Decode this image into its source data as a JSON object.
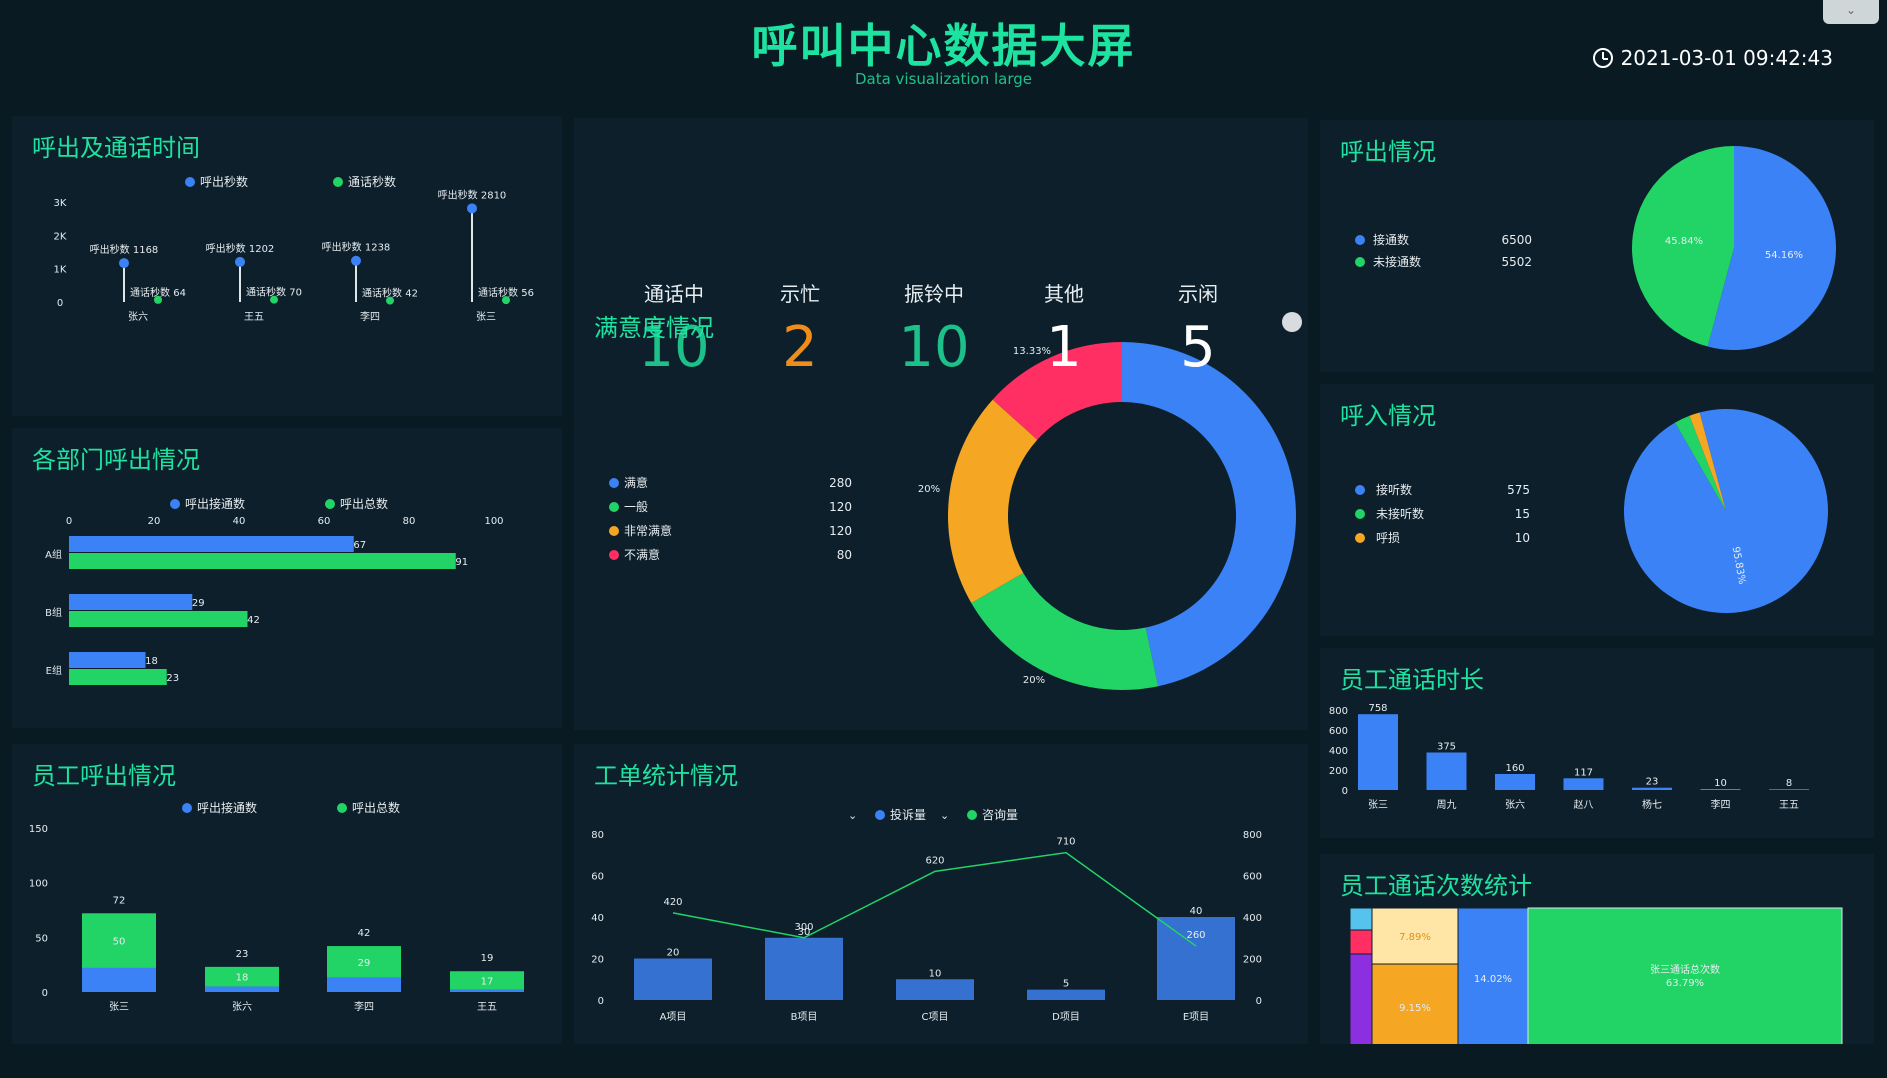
{
  "header": {
    "title": "呼叫中心数据大屏",
    "subtitle": "Data visualization large",
    "datetime": "2021-03-01 09:42:43"
  },
  "status": [
    {
      "label": "通话中",
      "value": "10",
      "color": "#1ec08a"
    },
    {
      "label": "示忙",
      "value": "2",
      "color": "#f08c1a"
    },
    {
      "label": "振铃中",
      "value": "10",
      "color": "#1ec08a"
    },
    {
      "label": "其他",
      "value": "1",
      "color": "#ffffff"
    },
    {
      "label": "示闲",
      "value": "5",
      "color": "#ffffff"
    }
  ],
  "panels": {
    "call_time": "呼出及通话时间",
    "dept": "各部门呼出情况",
    "staff_out": "员工呼出情况",
    "satisfaction": "满意度情况",
    "tickets": "工单统计情况",
    "outbound": "呼出情况",
    "inbound": "呼入情况",
    "duration": "员工通话时长",
    "count": "员工通话次数统计"
  },
  "colors": {
    "blue": "#3b82f6",
    "green": "#22d366",
    "orange": "#f5a623",
    "red": "#ff2e63"
  },
  "chart_data": [
    {
      "id": "call_time",
      "type": "scatter",
      "legend": [
        "呼出秒数",
        "通话秒数"
      ],
      "categories": [
        "张六",
        "王五",
        "李四",
        "张三"
      ],
      "series": [
        {
          "name": "呼出秒数",
          "values": [
            1168,
            1202,
            1238,
            2810
          ]
        },
        {
          "name": "通话秒数",
          "values": [
            64,
            70,
            42,
            56
          ]
        }
      ],
      "ylim": [
        0,
        3000
      ],
      "yticks": [
        "0",
        "1K",
        "2K",
        "3K"
      ]
    },
    {
      "id": "dept",
      "type": "bar",
      "orientation": "horizontal",
      "legend": [
        "呼出接通数",
        "呼出总数"
      ],
      "categories": [
        "A组",
        "B组",
        "E组"
      ],
      "series": [
        {
          "name": "呼出接通数",
          "values": [
            67,
            29,
            18
          ]
        },
        {
          "name": "呼出总数",
          "values": [
            91,
            42,
            23
          ]
        }
      ],
      "xlim": [
        0,
        100
      ],
      "xticks": [
        "0",
        "20",
        "40",
        "60",
        "80",
        "100"
      ]
    },
    {
      "id": "staff_out",
      "type": "bar",
      "stacked": true,
      "legend": [
        "呼出接通数",
        "呼出总数"
      ],
      "categories": [
        "张三",
        "张六",
        "李四",
        "王五"
      ],
      "series": [
        {
          "name": "呼出接通数",
          "values": [
            22,
            5,
            13,
            2
          ]
        },
        {
          "name": "呼出总数",
          "values": [
            50,
            18,
            29,
            17
          ]
        }
      ],
      "totals": [
        72,
        23,
        42,
        19
      ],
      "ylim": [
        0,
        150
      ],
      "yticks": [
        "0",
        "50",
        "100",
        "150"
      ]
    },
    {
      "id": "satisfaction",
      "type": "pie",
      "donut": true,
      "items": [
        {
          "name": "满意",
          "value": 280
        },
        {
          "name": "一般",
          "value": 120
        },
        {
          "name": "非常满意",
          "value": 120
        },
        {
          "name": "不满意",
          "value": 80
        }
      ],
      "labels": [
        "",
        "20%",
        "20%",
        "13.33%"
      ]
    },
    {
      "id": "tickets",
      "type": "bar",
      "legend": [
        "投诉量",
        "咨询量"
      ],
      "categories": [
        "A项目",
        "B项目",
        "C项目",
        "D项目",
        "E项目"
      ],
      "series": [
        {
          "name": "投诉量",
          "values": [
            20,
            30,
            10,
            5,
            40
          ]
        },
        {
          "name": "咨询量",
          "type": "line",
          "values": [
            420,
            300,
            620,
            710,
            260
          ]
        }
      ],
      "ylim_left": [
        0,
        80
      ],
      "yticks_left": [
        "0",
        "20",
        "40",
        "60",
        "80"
      ],
      "ylim_right": [
        0,
        800
      ],
      "yticks_right": [
        "0",
        "200",
        "400",
        "600",
        "800"
      ]
    },
    {
      "id": "outbound",
      "type": "pie",
      "items": [
        {
          "name": "接通数",
          "value": 6500
        },
        {
          "name": "未接通数",
          "value": 5502
        }
      ],
      "labels": [
        "54.16%",
        "45.84%"
      ]
    },
    {
      "id": "inbound",
      "type": "pie",
      "items": [
        {
          "name": "接听数",
          "value": 575
        },
        {
          "name": "未接听数",
          "value": 15
        },
        {
          "name": "呼损",
          "value": 10
        }
      ],
      "labels": [
        "95.83%"
      ]
    },
    {
      "id": "duration",
      "type": "bar",
      "categories": [
        "张三",
        "周九",
        "张六",
        "赵八",
        "杨七",
        "李四",
        "王五"
      ],
      "values": [
        758,
        375,
        160,
        117,
        23,
        10,
        8
      ],
      "ylim": [
        0,
        800
      ],
      "yticks": [
        "0",
        "200",
        "400",
        "600",
        "800"
      ]
    },
    {
      "id": "count",
      "type": "treemap",
      "labels": [
        "张三通话总次数",
        "63.79%",
        "14.02%",
        "9.15%",
        "7.89%"
      ]
    }
  ]
}
